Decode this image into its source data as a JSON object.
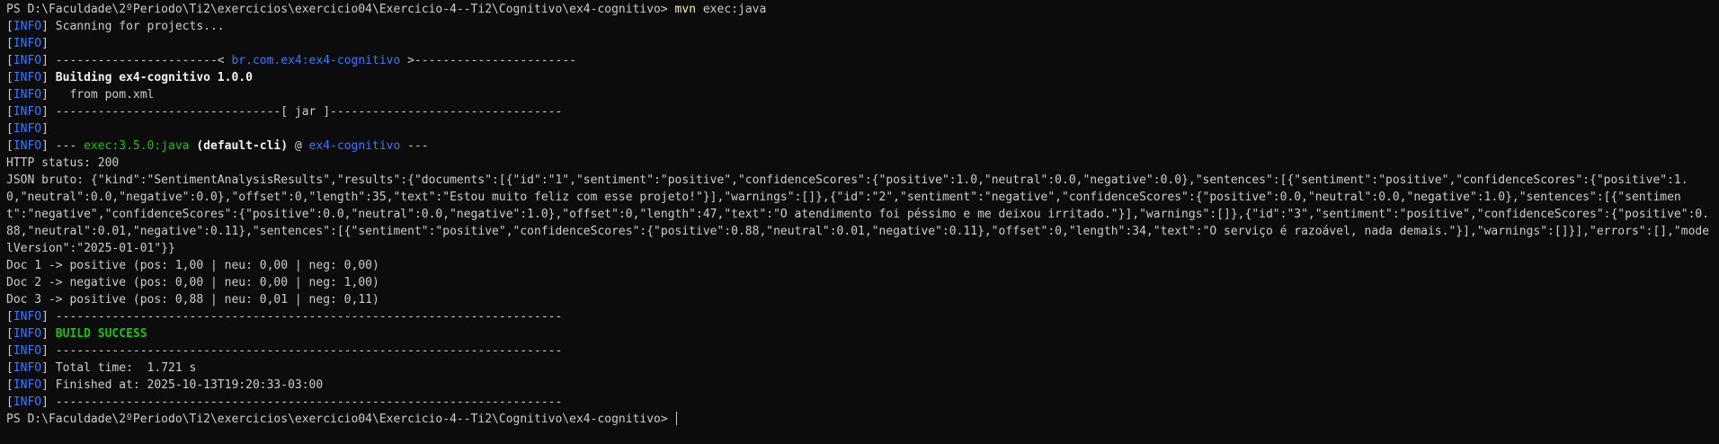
{
  "terminal": {
    "prompt_path": "PS D:\\Faculdade\\2ºPeriodo\\Ti2\\exercicios\\exercicio04\\Exercicio-4--Ti2\\Cognitivo\\ex4-cognitivo>",
    "command_name": "mvn",
    "command_args": "exec:java",
    "info_tag": "INFO",
    "lines": {
      "scanning": "Scanning for projects...",
      "artifact_sep_left": "-----------------------< ",
      "artifact_id": "br.com.ex4:ex4-cognitivo",
      "artifact_sep_right": " >-----------------------",
      "building_label": "Building ex4-cognitivo 1.0.0",
      "from_pom": "  from pom.xml",
      "jar_sep": "--------------------------------[ jar ]---------------------------------",
      "exec_prefix": "--- ",
      "exec_plugin": "exec:3.5.0:java",
      "exec_goal": " (default-cli)",
      "exec_at": " @ ",
      "exec_project": "ex4-cognitivo",
      "exec_suffix": " ---",
      "http_status": "HTTP status: 200",
      "json_raw": "JSON bruto: {\"kind\":\"SentimentAnalysisResults\",\"results\":{\"documents\":[{\"id\":\"1\",\"sentiment\":\"positive\",\"confidenceScores\":{\"positive\":1.0,\"neutral\":0.0,\"negative\":0.0},\"sentences\":[{\"sentiment\":\"positive\",\"confidenceScores\":{\"positive\":1.0,\"neutral\":0.0,\"negative\":0.0},\"offset\":0,\"length\":35,\"text\":\"Estou muito feliz com esse projeto!\"}],\"warnings\":[]},{\"id\":\"2\",\"sentiment\":\"negative\",\"confidenceScores\":{\"positive\":0.0,\"neutral\":0.0,\"negative\":1.0},\"sentences\":[{\"sentiment\":\"negative\",\"confidenceScores\":{\"positive\":0.0,\"neutral\":0.0,\"negative\":1.0},\"offset\":0,\"length\":47,\"text\":\"O atendimento foi péssimo e me deixou irritado.\"}],\"warnings\":[]},{\"id\":\"3\",\"sentiment\":\"positive\",\"confidenceScores\":{\"positive\":0.88,\"neutral\":0.01,\"negative\":0.11},\"sentences\":[{\"sentiment\":\"positive\",\"confidenceScores\":{\"positive\":0.88,\"neutral\":0.01,\"negative\":0.11},\"offset\":0,\"length\":34,\"text\":\"O serviço é razoável, nada demais.\"}],\"warnings\":[]}],\"errors\":[],\"modelVersion\":\"2025-01-01\"}}",
      "doc1": "Doc 1 -> positive (pos: 1,00 | neu: 0,00 | neg: 0,00)",
      "doc2": "Doc 2 -> negative (pos: 0,00 | neu: 0,00 | neg: 1,00)",
      "doc3": "Doc 3 -> positive (pos: 0,88 | neu: 0,01 | neg: 0,11)",
      "long_sep": "------------------------------------------------------------------------",
      "build_success": "BUILD SUCCESS",
      "total_time": "Total time:  1.721 s",
      "finished_at": "Finished at: 2025-10-13T19:20:33-03:00"
    }
  }
}
